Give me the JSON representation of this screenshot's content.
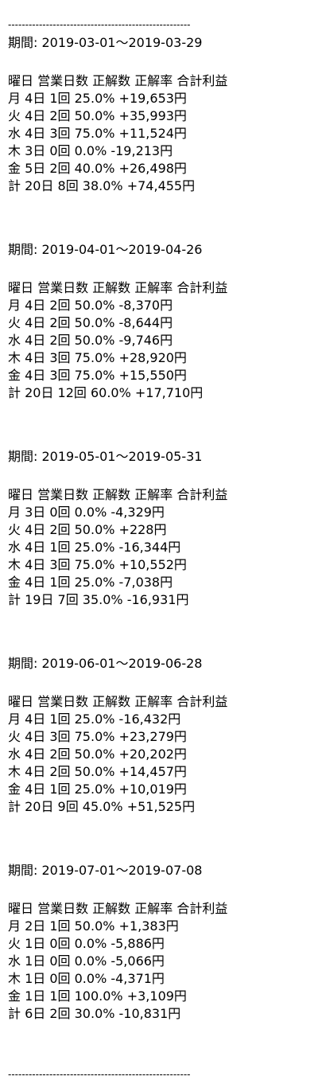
{
  "separator": "-----------------------------------------------------",
  "blocks": [
    {
      "period": "期間: 2019-03-01〜2019-03-29",
      "header": "曜日 営業日数 正解数 正解率 合計利益",
      "rows": [
        "月 4日 1回 25.0% +19,653円",
        "火 4日 2回 50.0% +35,993円",
        "水 4日 3回 75.0% +11,524円",
        "木 3日 0回 0.0% -19,213円",
        "金 5日 2回 40.0% +26,498円",
        "計 20日 8回 38.0% +74,455円"
      ]
    },
    {
      "period": "期間: 2019-04-01〜2019-04-26",
      "header": "曜日 営業日数 正解数 正解率 合計利益",
      "rows": [
        "月 4日 2回 50.0% -8,370円",
        "火 4日 2回 50.0% -8,644円",
        "水 4日 2回 50.0% -9,746円",
        "木 4日 3回 75.0% +28,920円",
        "金 4日 3回 75.0% +15,550円",
        "計 20日 12回 60.0% +17,710円"
      ]
    },
    {
      "period": "期間: 2019-05-01〜2019-05-31",
      "header": "曜日 営業日数 正解数 正解率 合計利益",
      "rows": [
        "月 3日 0回 0.0% -4,329円",
        "火 4日 2回 50.0% +228円",
        "水 4日 1回 25.0% -16,344円",
        "木 4日 3回 75.0% +10,552円",
        "金 4日 1回 25.0% -7,038円",
        "計 19日 7回 35.0% -16,931円"
      ]
    },
    {
      "period": "期間: 2019-06-01〜2019-06-28",
      "header": "曜日 営業日数 正解数 正解率 合計利益",
      "rows": [
        "月 4日 1回 25.0% -16,432円",
        "火 4日 3回 75.0% +23,279円",
        "水 4日 2回 50.0% +20,202円",
        "木 4日 2回 50.0% +14,457円",
        "金 4日 1回 25.0% +10,019円",
        "計 20日 9回 45.0% +51,525円"
      ]
    },
    {
      "period": "期間: 2019-07-01〜2019-07-08",
      "header": "曜日 営業日数 正解数 正解率 合計利益",
      "rows": [
        "月 2日 1回 50.0% +1,383円",
        "火 1日 0回 0.0% -5,886円",
        "水 1日 0回 0.0% -5,066円",
        "木 1日 0回 0.0% -4,371円",
        "金 1日 1回 100.0% +3,109円",
        "計 6日 2回 30.0% -10,831円"
      ]
    }
  ]
}
